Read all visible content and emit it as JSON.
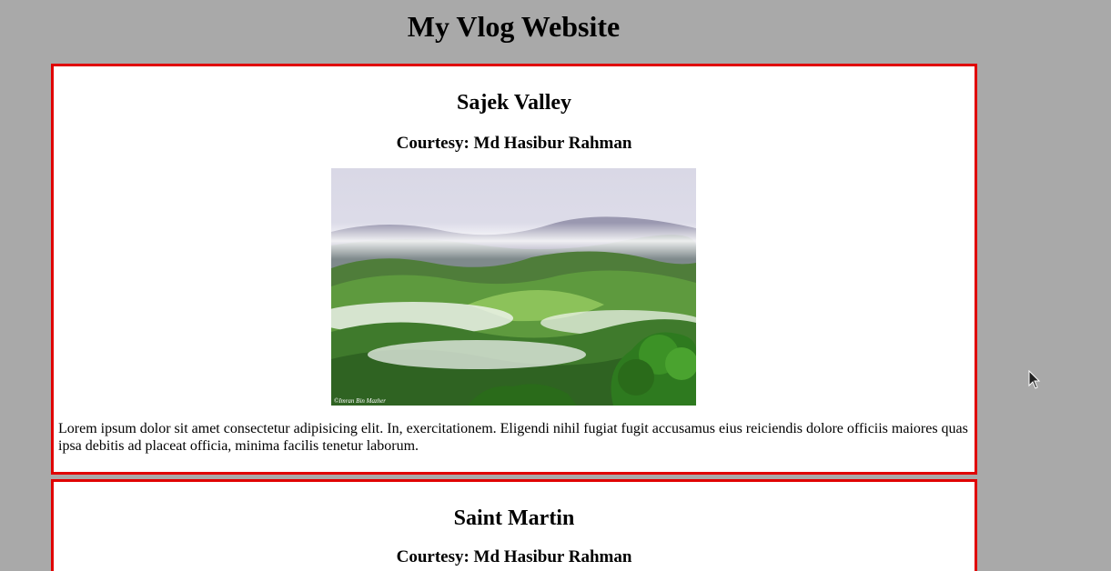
{
  "site": {
    "title": "My Vlog Website"
  },
  "posts": [
    {
      "title": "Sajek Valley",
      "courtesy": "Courtesy: Md Hasibur Rahman",
      "image_alt": "Misty green hills of Sajek Valley",
      "watermark": "©Imran Bin Mazher",
      "body": "Lorem ipsum dolor sit amet consectetur adipisicing elit. In, exercitationem. Eligendi nihil fugiat fugit accusamus eius reiciendis dolore officiis maiores quas ipsa debitis ad placeat officia, minima facilis tenetur laborum."
    },
    {
      "title": "Saint Martin",
      "courtesy": "Courtesy: Md Hasibur Rahman"
    }
  ],
  "colors": {
    "page_background": "#a9a9a9",
    "card_background": "#ffffff",
    "card_border": "#e00000"
  },
  "icons": {
    "cursor": "mouse-pointer-icon"
  }
}
